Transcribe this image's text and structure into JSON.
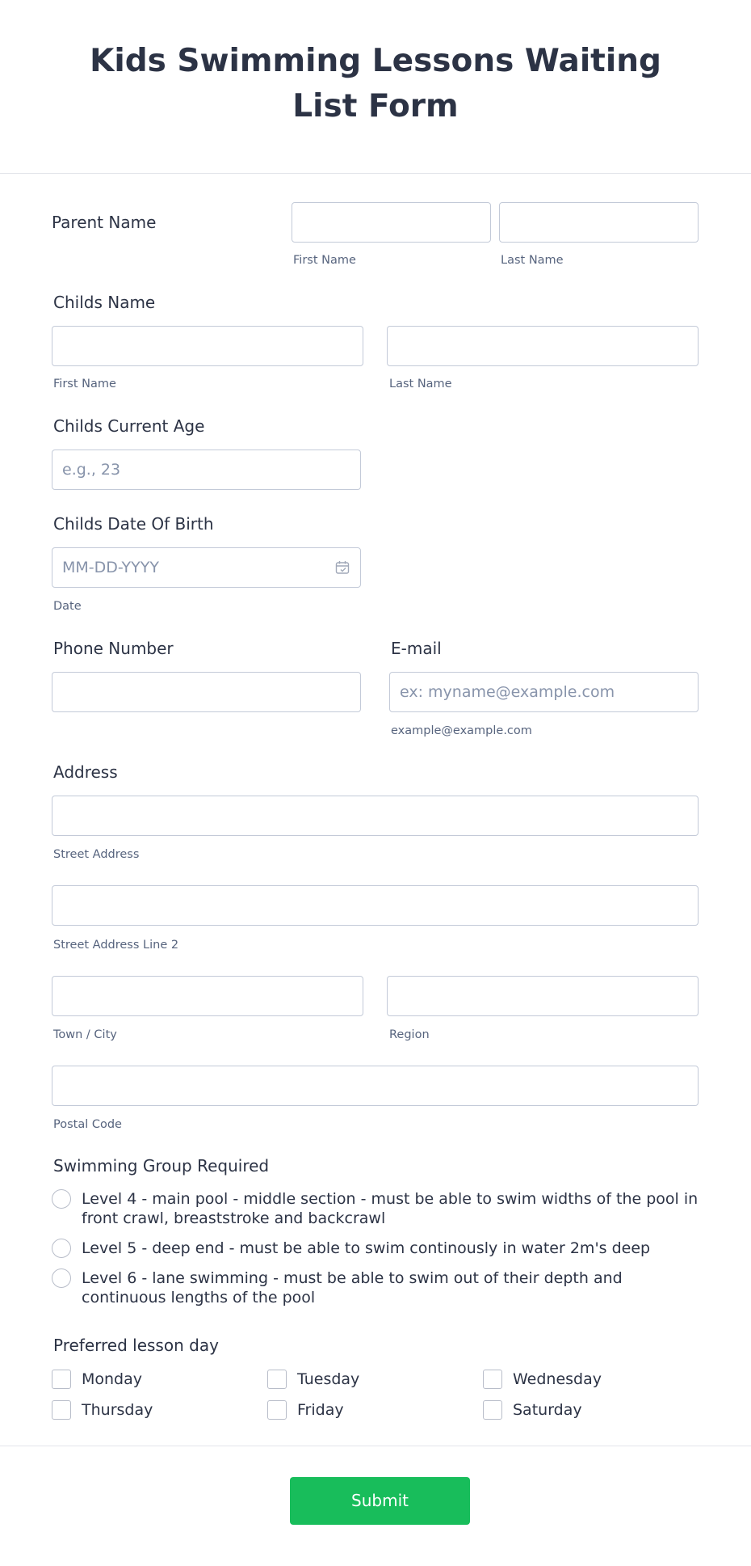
{
  "form": {
    "title": "Kids Swimming Lessons Waiting List Form",
    "parent_name": {
      "label": "Parent Name",
      "first_sub": "First Name",
      "last_sub": "Last Name"
    },
    "child_name": {
      "label": "Childs Name",
      "first_sub": "First Name",
      "last_sub": "Last Name"
    },
    "child_age": {
      "label": "Childs Current Age",
      "placeholder": "e.g., 23"
    },
    "child_dob": {
      "label": "Childs Date Of Birth",
      "placeholder": "MM-DD-YYYY",
      "sub": "Date"
    },
    "phone": {
      "label": "Phone Number"
    },
    "email": {
      "label": "E-mail",
      "placeholder": "ex: myname@example.com",
      "sub": "example@example.com"
    },
    "address": {
      "label": "Address",
      "street_sub": "Street Address",
      "street2_sub": "Street Address Line 2",
      "city_sub": "Town / City",
      "region_sub": "Region",
      "postal_sub": "Postal Code"
    },
    "swimming_group": {
      "label": "Swimming Group Required",
      "options": [
        "Level 4 - main pool - middle section - must be able to swim widths of the pool in front crawl, breaststroke and backcrawl",
        "Level 5 - deep end - must be able to swim continously in water 2m's deep",
        "Level 6 - lane swimming - must be able to swim out of their depth and continuous lengths of the pool"
      ]
    },
    "lesson_day": {
      "label": "Preferred lesson day",
      "options": [
        "Monday",
        "Tuesday",
        "Wednesday",
        "Thursday",
        "Friday",
        "Saturday"
      ]
    },
    "submit_label": "Submit",
    "colors": {
      "accent": "#18bd5b",
      "text": "#2c3345",
      "border": "#c3cad8"
    }
  }
}
